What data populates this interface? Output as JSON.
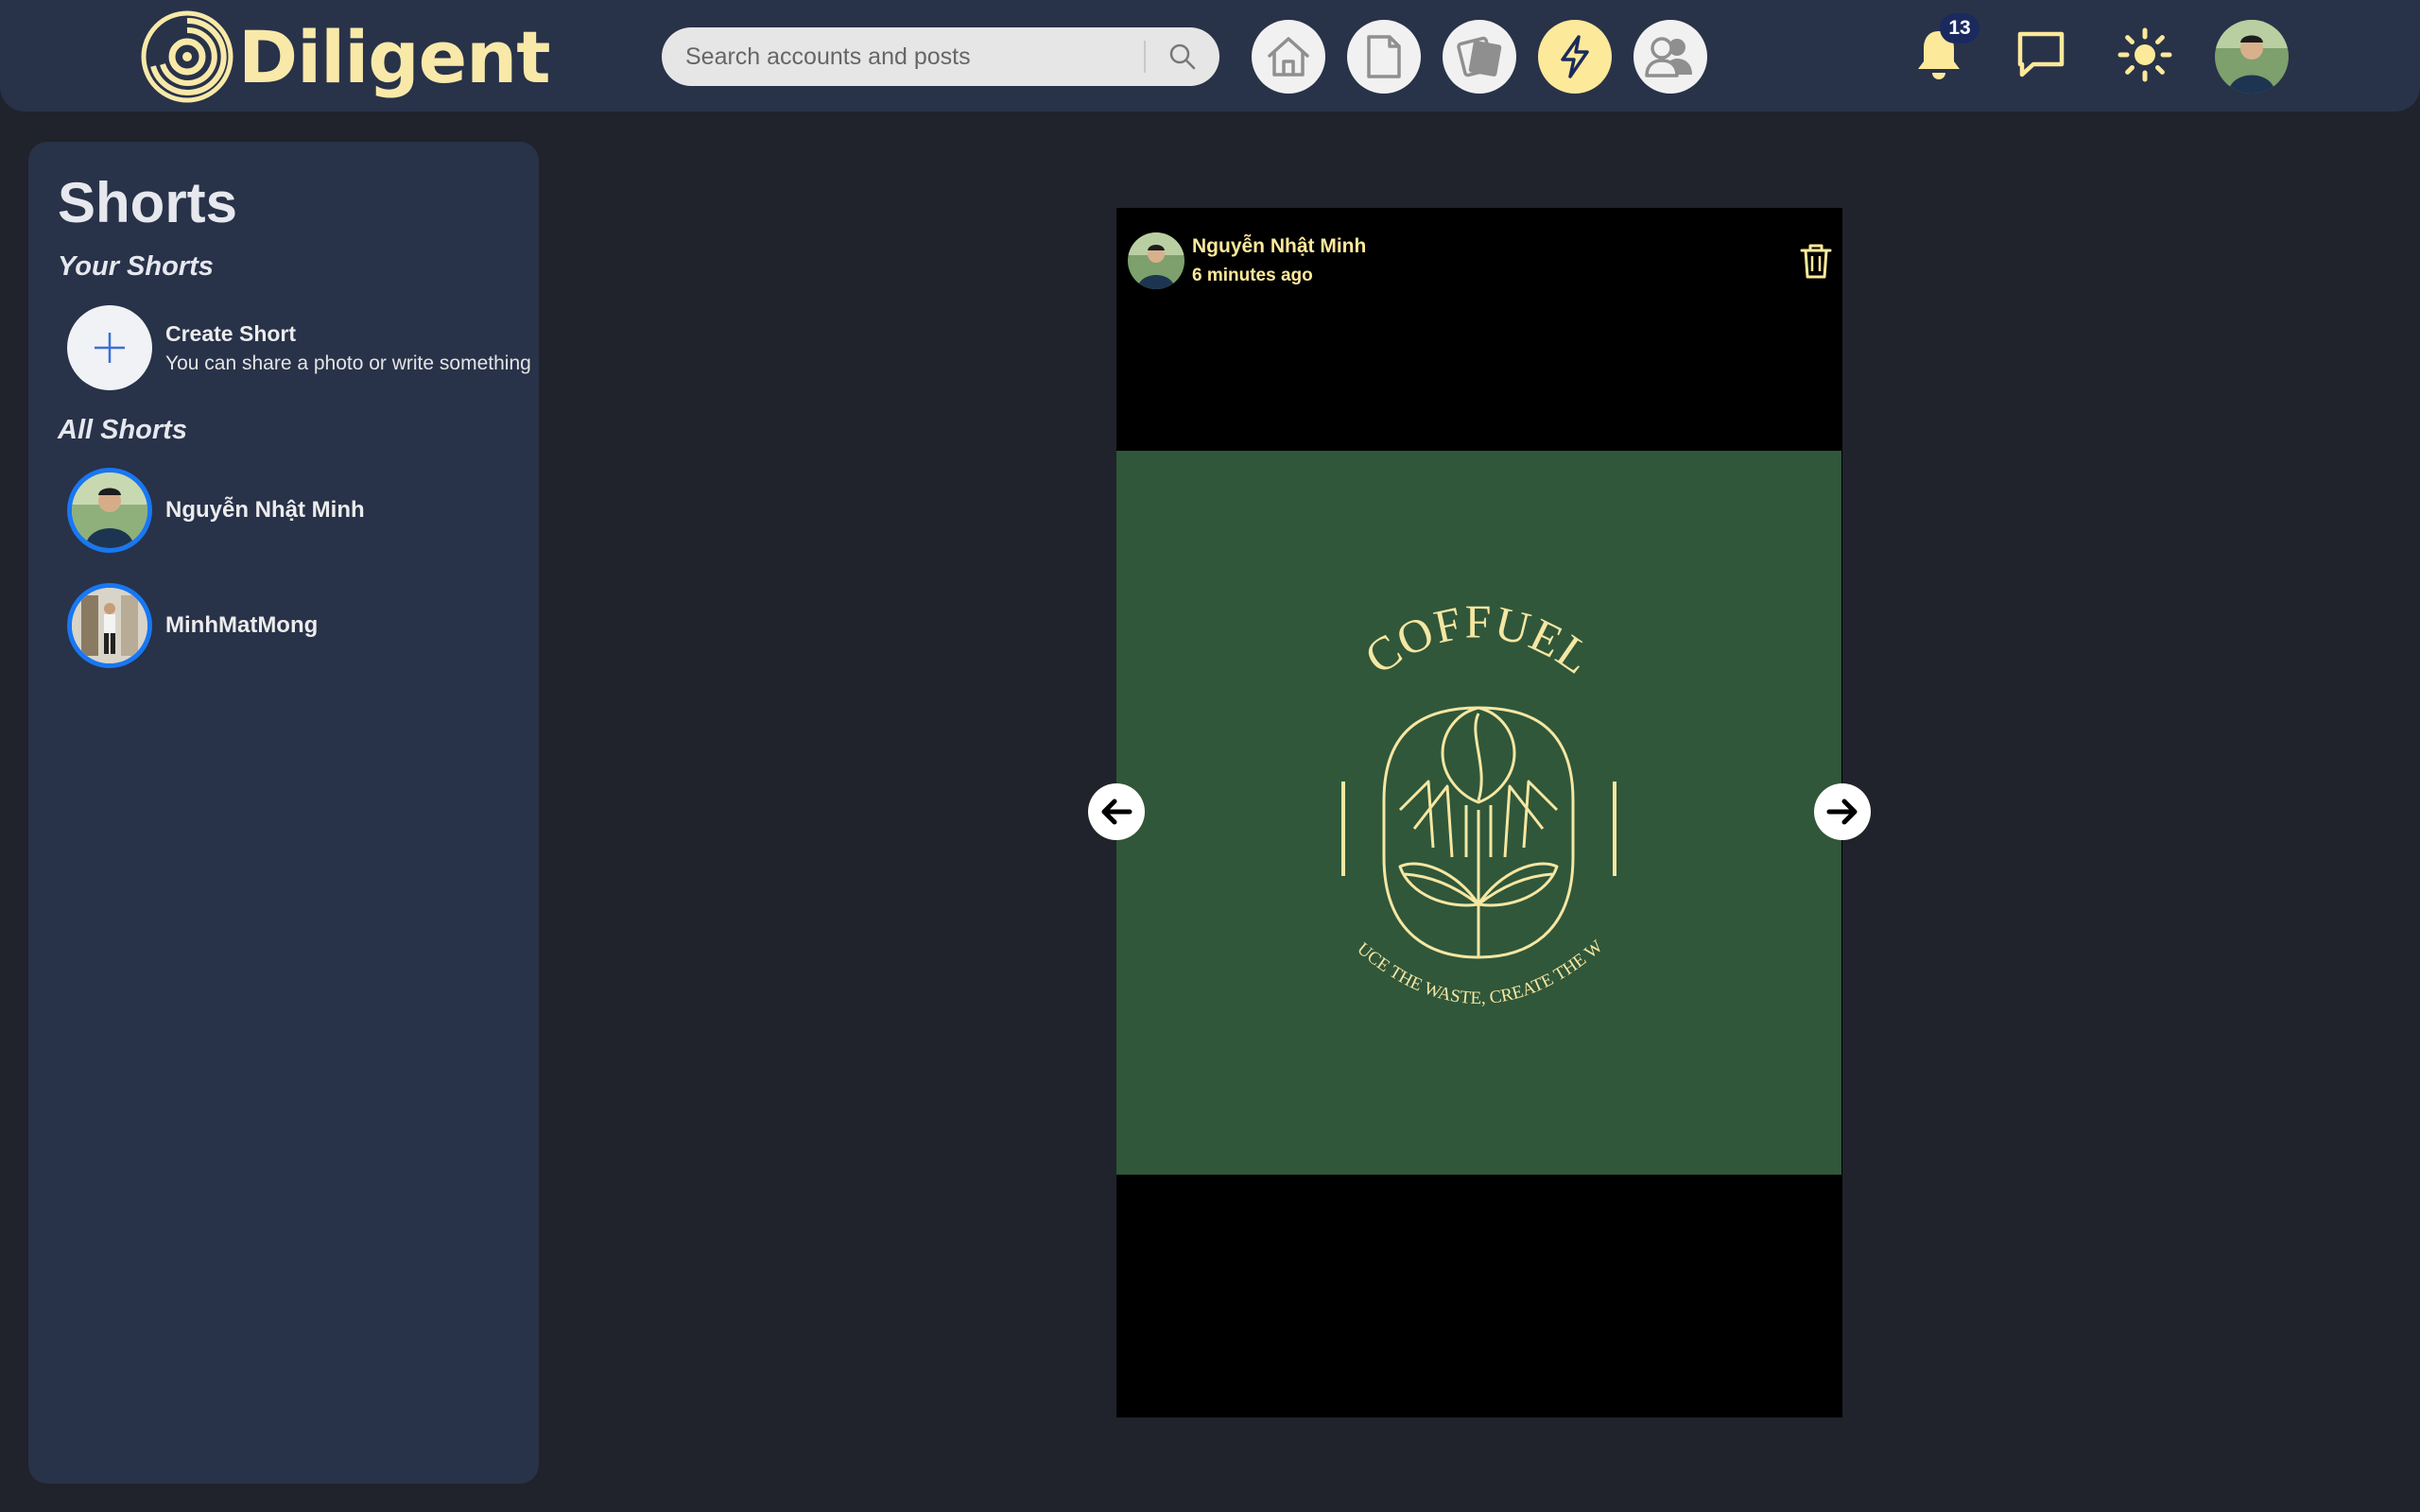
{
  "app": {
    "name": "Diligent",
    "accent_color": "#fde99a",
    "header_color": "#283249",
    "background_color": "#20232b"
  },
  "header": {
    "search_placeholder": "Search accounts and posts",
    "nav": [
      {
        "name": "home",
        "icon": "home-icon",
        "active": false
      },
      {
        "name": "posts",
        "icon": "document-icon",
        "active": false
      },
      {
        "name": "gallery",
        "icon": "cards-icon",
        "active": false
      },
      {
        "name": "shorts",
        "icon": "lightning-icon",
        "active": true
      },
      {
        "name": "friends",
        "icon": "users-icon",
        "active": false
      }
    ],
    "notifications_count": "13",
    "icons": [
      "bell-icon",
      "chat-icon",
      "sun-icon"
    ]
  },
  "sidebar": {
    "title": "Shorts",
    "your_shorts_label": "Your Shorts",
    "create": {
      "title": "Create Short",
      "subtitle": "You can share a photo or write something"
    },
    "all_shorts_label": "All Shorts",
    "shorts": [
      {
        "name": "Nguyễn Nhật Minh"
      },
      {
        "name": "MinhMatMong"
      }
    ]
  },
  "post": {
    "author": "Nguyễn Nhật Minh",
    "time": "6 minutes ago",
    "image_bg": "#30573a",
    "logo_title": "COFFUEL",
    "logo_tagline": "REDUCE THE WASTE, CREATE THE WAYS"
  }
}
